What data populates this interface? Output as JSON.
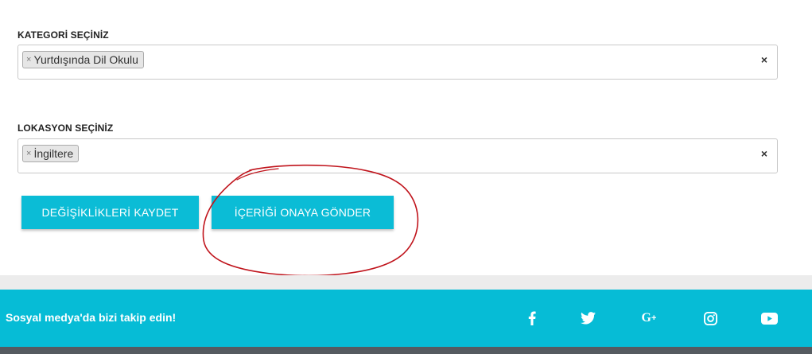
{
  "category": {
    "label": "KATEGORİ SEÇİNİZ",
    "chip_remove": "×",
    "chip_value": "Yurtdışında Dil Okulu",
    "clear": "×"
  },
  "location": {
    "label": "LOKASYON SEÇİNİZ",
    "chip_remove": "×",
    "chip_value": "İngiltere",
    "clear": "×"
  },
  "actions": {
    "save_label": "DEĞİŞİKLİKLERİ KAYDET",
    "submit_label": "İÇERİĞİ ONAYA GÖNDER"
  },
  "footer": {
    "follow_text": "Sosyal medya'da bizi takip edin!",
    "social_icons": [
      "facebook-icon",
      "twitter-icon",
      "google-plus-icon",
      "instagram-icon",
      "youtube-icon"
    ]
  },
  "colors": {
    "accent": "#0bbcd6",
    "footer_bg": "#06bcd6",
    "annotation": "#c0141c"
  }
}
